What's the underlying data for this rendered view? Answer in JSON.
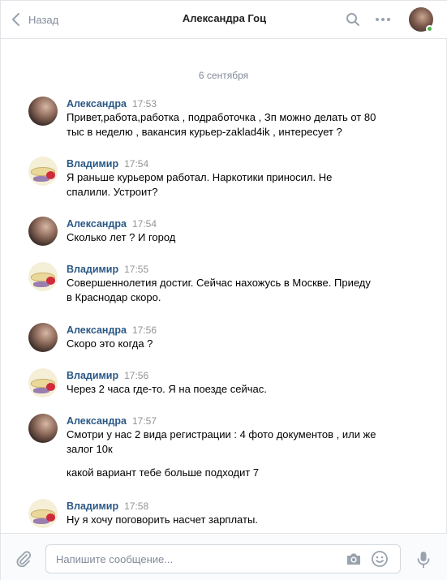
{
  "header": {
    "back_label": "Назад",
    "title": "Александра Гоц"
  },
  "date_separator": "6 сентября",
  "messages": [
    {
      "author": "Александра",
      "time": "17:53",
      "lines": [
        "Привет,работа,работка , подработочка , Зп можно делать от 80",
        "тыс в неделю , вакансия курьер-zaklad4ik , интересует ?"
      ]
    },
    {
      "author": "Владимир",
      "time": "17:54",
      "lines": [
        "Я раньше курьером работал. Наркотики приносил. Не",
        "спалили. Устроит?"
      ]
    },
    {
      "author": "Александра",
      "time": "17:54",
      "lines": [
        "Сколько лет ? И город"
      ]
    },
    {
      "author": "Владимир",
      "time": "17:55",
      "lines": [
        "Совершеннолетия достиг. Сейчас нахожусь в Москве. Приеду",
        "в Краснодар скоро."
      ]
    },
    {
      "author": "Александра",
      "time": "17:56",
      "lines": [
        "Скоро это когда ?"
      ]
    },
    {
      "author": "Владимир",
      "time": "17:56",
      "lines": [
        "Через 2 часа где-то. Я на поезде сейчас."
      ]
    },
    {
      "author": "Александра",
      "time": "17:57",
      "lines": [
        "Смотри у нас 2 вида регистрации : 4 фото документов , или же",
        "залог 10к"
      ],
      "extra": "какой вариант тебе больше подходит 7"
    },
    {
      "author": "Владимир",
      "time": "17:58",
      "lines": [
        "Ну я хочу поговорить насчет зарплаты."
      ]
    }
  ],
  "composer": {
    "placeholder": "Напишите сообщение..."
  },
  "icons": {
    "back": "chevron-left-icon",
    "search": "search-icon",
    "more": "more-dots-icon",
    "attach": "paperclip-icon",
    "camera": "camera-icon",
    "emoji": "smile-icon",
    "voice": "microphone-icon"
  },
  "colors": {
    "name_link": "#2a5885",
    "muted": "#828a99",
    "online": "#4bb34b"
  }
}
